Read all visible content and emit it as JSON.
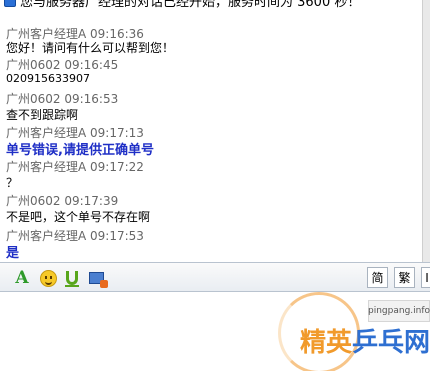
{
  "top_line": "您与服务器广经理的对话已经开始，服务时间为 3600 秒！",
  "messages": [
    {
      "header": "广州客户经理A 09:16:36",
      "text": "您好！请问有什么可以帮到您！",
      "style": "normal"
    },
    {
      "header": "广州0602 09:16:45",
      "text": "020915633907",
      "style": "small"
    },
    {
      "header": "广州0602 09:16:53",
      "text": "查不到跟踪啊",
      "style": "normal"
    },
    {
      "header": "广州客户经理A 09:17:13",
      "text": "单号错误,请提供正确单号",
      "style": "bold"
    },
    {
      "header": "广州客户经理A 09:17:22",
      "text": "？",
      "style": "normal"
    },
    {
      "header": "广州0602 09:17:39",
      "text": "不是吧，这个单号不存在啊",
      "style": "normal"
    },
    {
      "header": "广州客户经理A 09:17:53",
      "text": "是",
      "style": "bold"
    }
  ],
  "toolbar": {
    "icons": [
      "font-icon",
      "emoji-icon",
      "file-transfer-icon",
      "screenshot-icon"
    ],
    "simplified_label": "简",
    "traditional_label": "繁",
    "more_label": "I"
  },
  "watermark": {
    "url": "pingpang.info",
    "logo_part1": "精英",
    "logo_part2": "乒乓网"
  },
  "colors": {
    "header_text": "#666666",
    "emphasis_text": "#1f2fc6",
    "toolbar_border": "#b9c3cf",
    "logo_orange": "#f19a2b",
    "logo_blue": "#2e6fd1"
  }
}
